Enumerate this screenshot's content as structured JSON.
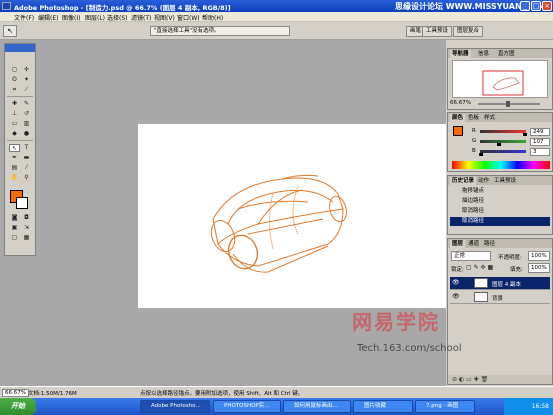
{
  "titlebar": {
    "title": "Adobe Photoshop - [制造力.psd @ 66.7% (图层 4 副本, RGB/8)]",
    "watermark": "思缘设计论坛 WWW.MISSYUAN.COM",
    "buttons": [
      "_",
      "□",
      "×"
    ]
  },
  "menu": [
    "文件(F)",
    "编辑(E)",
    "图像(I)",
    "图层(L)",
    "选择(S)",
    "滤镜(T)",
    "视图(V)",
    "窗口(W)",
    "帮助(H)"
  ],
  "options": {
    "tool_glyph": "↖",
    "hint": "\"直接选择工具\"没有选项。",
    "wells": [
      "画笔",
      "工具预设",
      "图层复合"
    ]
  },
  "navigator": {
    "tabs": [
      "导航器",
      "信息",
      "直方图"
    ],
    "zoom": "66.67%"
  },
  "color": {
    "tabs": [
      "颜色",
      "色板",
      "样式"
    ],
    "channels": [
      {
        "label": "R",
        "value": "249",
        "fraction": 0.976,
        "color": "#e33"
      },
      {
        "label": "G",
        "value": "107",
        "fraction": 0.42,
        "color": "#3a3"
      },
      {
        "label": "B",
        "value": "3",
        "fraction": 0.012,
        "color": "#33d"
      }
    ],
    "foreground": "#ff6a00"
  },
  "history": {
    "tabs": [
      "历史记录",
      "动作",
      "工具预设"
    ],
    "items": [
      "拖移锚点",
      "描边路径",
      "取消路径",
      "取消路径"
    ]
  },
  "layers": {
    "tabs": [
      "图层",
      "通道",
      "路径"
    ],
    "blend_mode": "正常",
    "opacity_label": "不透明度:",
    "opacity": "100%",
    "lock_label": "锁定:",
    "fill_label": "填充:",
    "fill": "100%",
    "rows": [
      {
        "name": "图层 4 副本",
        "selected": true
      },
      {
        "name": "背景",
        "selected": false
      }
    ]
  },
  "status": {
    "zoom": "66.67%",
    "doc": "文档:1.50M/1.76M",
    "message": "点按以选择路径锚点。要用附加选项，使用 Shift、Alt 和 Ctrl 键。"
  },
  "watermark": {
    "cn": "网易学院",
    "url": "Tech.163.com/school"
  },
  "taskbar": {
    "start": "开始",
    "items": [
      {
        "label": "Adobe Photosho...",
        "active": true
      },
      {
        "label": "PHOTOSHOP实...",
        "active": false
      },
      {
        "label": "如何用鼠标画出...",
        "active": false
      },
      {
        "label": "图片收藏",
        "active": false
      },
      {
        "label": "7.png - 画图",
        "active": false
      }
    ],
    "clock": "16:58"
  }
}
